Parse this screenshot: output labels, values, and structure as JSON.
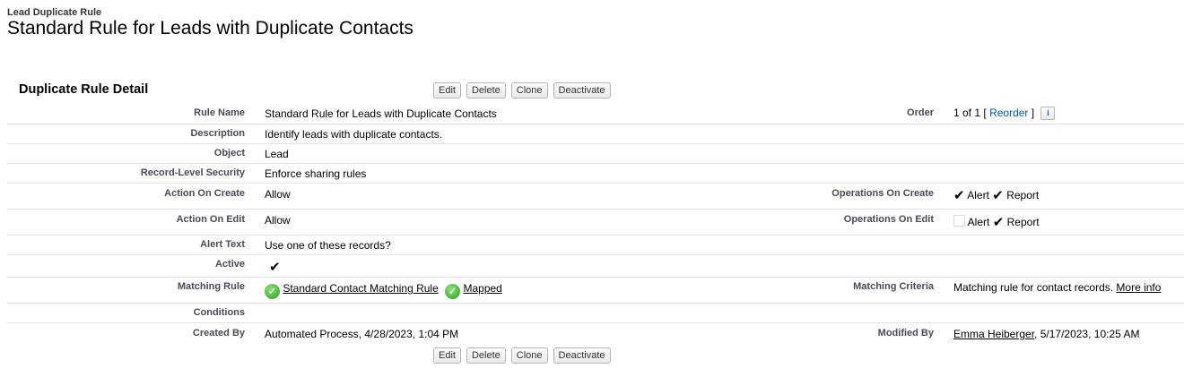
{
  "header": {
    "type_label": "Lead Duplicate Rule",
    "title": "Standard Rule for Leads with Duplicate Contacts"
  },
  "section": {
    "title": "Duplicate Rule Detail"
  },
  "buttons": {
    "edit": "Edit",
    "delete": "Delete",
    "clone": "Clone",
    "deactivate": "Deactivate"
  },
  "fields": {
    "rule_name": {
      "label": "Rule Name",
      "value": "Standard Rule for Leads with Duplicate Contacts"
    },
    "order": {
      "label": "Order",
      "value": "1 of 1",
      "bracket_open": "[",
      "reorder": "Reorder",
      "bracket_close": "]",
      "info_icon": "i"
    },
    "description": {
      "label": "Description",
      "value": "Identify leads with duplicate contacts."
    },
    "object": {
      "label": "Object",
      "value": "Lead"
    },
    "record_security": {
      "label": "Record-Level Security",
      "value": "Enforce sharing rules"
    },
    "action_on_create": {
      "label": "Action On Create",
      "value": "Allow"
    },
    "ops_on_create": {
      "label": "Operations On Create",
      "alert": "Alert",
      "report": "Report",
      "alert_checked": true,
      "report_checked": true
    },
    "action_on_edit": {
      "label": "Action On Edit",
      "value": "Allow"
    },
    "ops_on_edit": {
      "label": "Operations On Edit",
      "alert": "Alert",
      "report": "Report",
      "alert_checked": false,
      "report_checked": true
    },
    "alert_text": {
      "label": "Alert Text",
      "value": "Use one of these records?"
    },
    "active": {
      "label": "Active",
      "checked": true
    },
    "matching_rule": {
      "label": "Matching Rule",
      "rule_link": "Standard Contact Matching Rule",
      "mapped_link": "Mapped"
    },
    "matching_criteria": {
      "label": "Matching Criteria",
      "value": "Matching rule for contact records.",
      "more_info": "More info"
    },
    "conditions": {
      "label": "Conditions",
      "value": ""
    },
    "created_by": {
      "label": "Created By",
      "value": "Automated Process, 4/28/2023, 1:04 PM"
    },
    "modified_by": {
      "label": "Modified By",
      "user": "Emma Heiberger",
      "date": ", 5/17/2023, 10:25 AM"
    }
  },
  "icons": {
    "check": "checkmark-icon",
    "ok": "green-check-circle-icon",
    "info": "info-icon"
  }
}
